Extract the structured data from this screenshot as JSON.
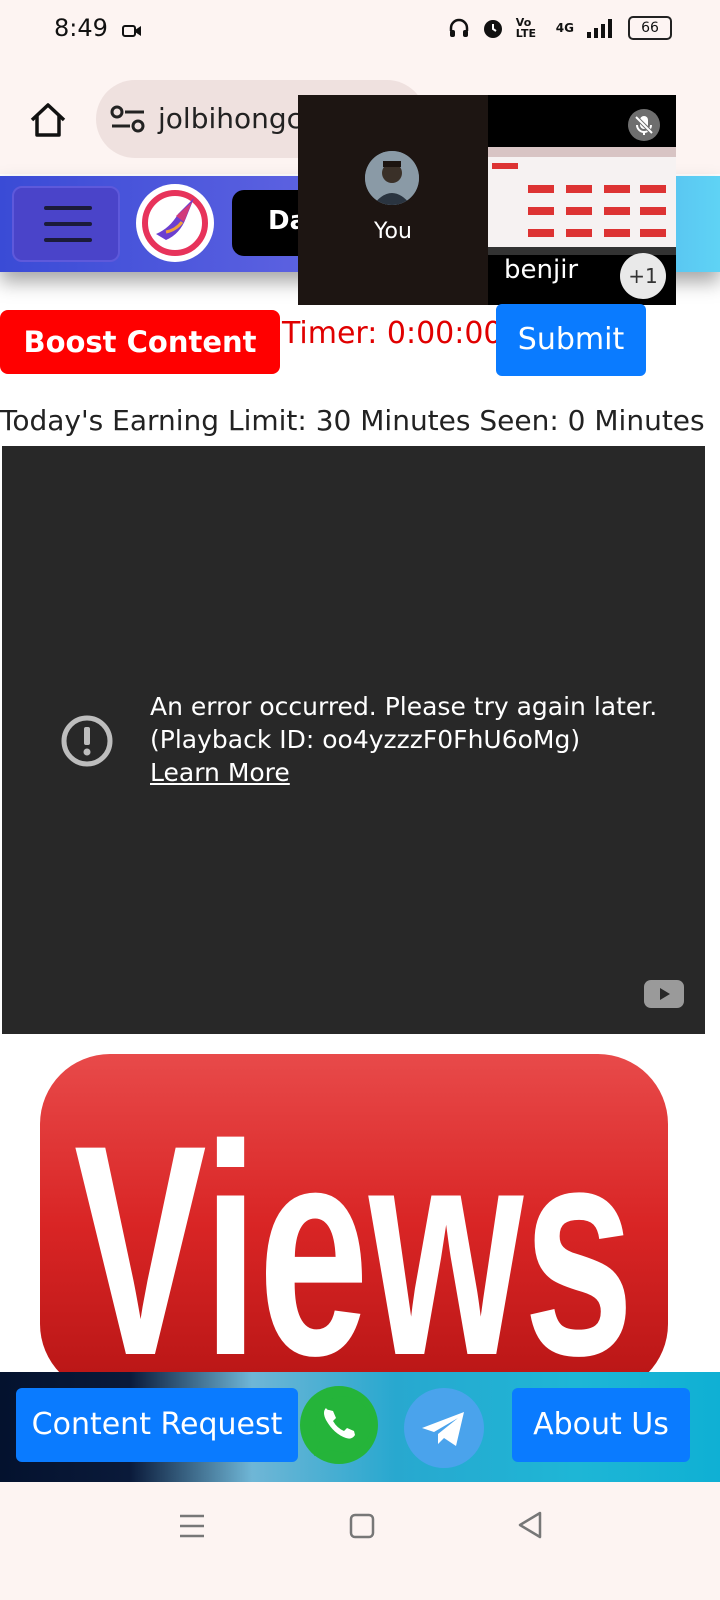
{
  "status_bar": {
    "time": "8:49",
    "network_label": "Vo LTE",
    "signal_label": "4G",
    "battery": "66",
    "icons": [
      "video-camera-icon",
      "headphones-icon",
      "alarm-icon",
      "volte-icon",
      "signal-4g-icon",
      "signal-bars-icon",
      "battery-icon"
    ]
  },
  "browser": {
    "url_text": "jolbihongc",
    "icons": [
      "home-icon",
      "site-settings-icon"
    ]
  },
  "site_header": {
    "dashboard_label": "Da"
  },
  "call_overlay": {
    "self_label": "You",
    "participant_name": "benjir",
    "extra_count": "+1",
    "icons": [
      "mic-off-icon"
    ]
  },
  "controls": {
    "boost_label": "Boost Content",
    "timer_text": "Timer: 0:00:00",
    "submit_label": "Submit",
    "limit_text": "Today's Earning Limit: 30 Minutes Seen: 0 Minutes"
  },
  "player": {
    "error_line1": "An error occurred. Please try again later.",
    "error_line2": "(Playback ID: oo4yzzzF0FhU6oMg)",
    "learn_more": "Learn More",
    "icons": [
      "error-icon",
      "youtube-icon"
    ]
  },
  "banner": {
    "views_text": "Views",
    "colors": {
      "red": "#d92525",
      "text": "#ffffff"
    }
  },
  "footer": {
    "content_request": "Content Request",
    "about_us": "About Us",
    "icons": [
      "whatsapp-icon",
      "telegram-icon"
    ]
  },
  "nav_bar": {
    "icons": [
      "menu-nav-icon",
      "home-nav-icon",
      "back-nav-icon"
    ]
  },
  "colors": {
    "accent_blue": "#0a7bff",
    "boost_red": "#ff0000",
    "timer_red": "#e00000"
  }
}
